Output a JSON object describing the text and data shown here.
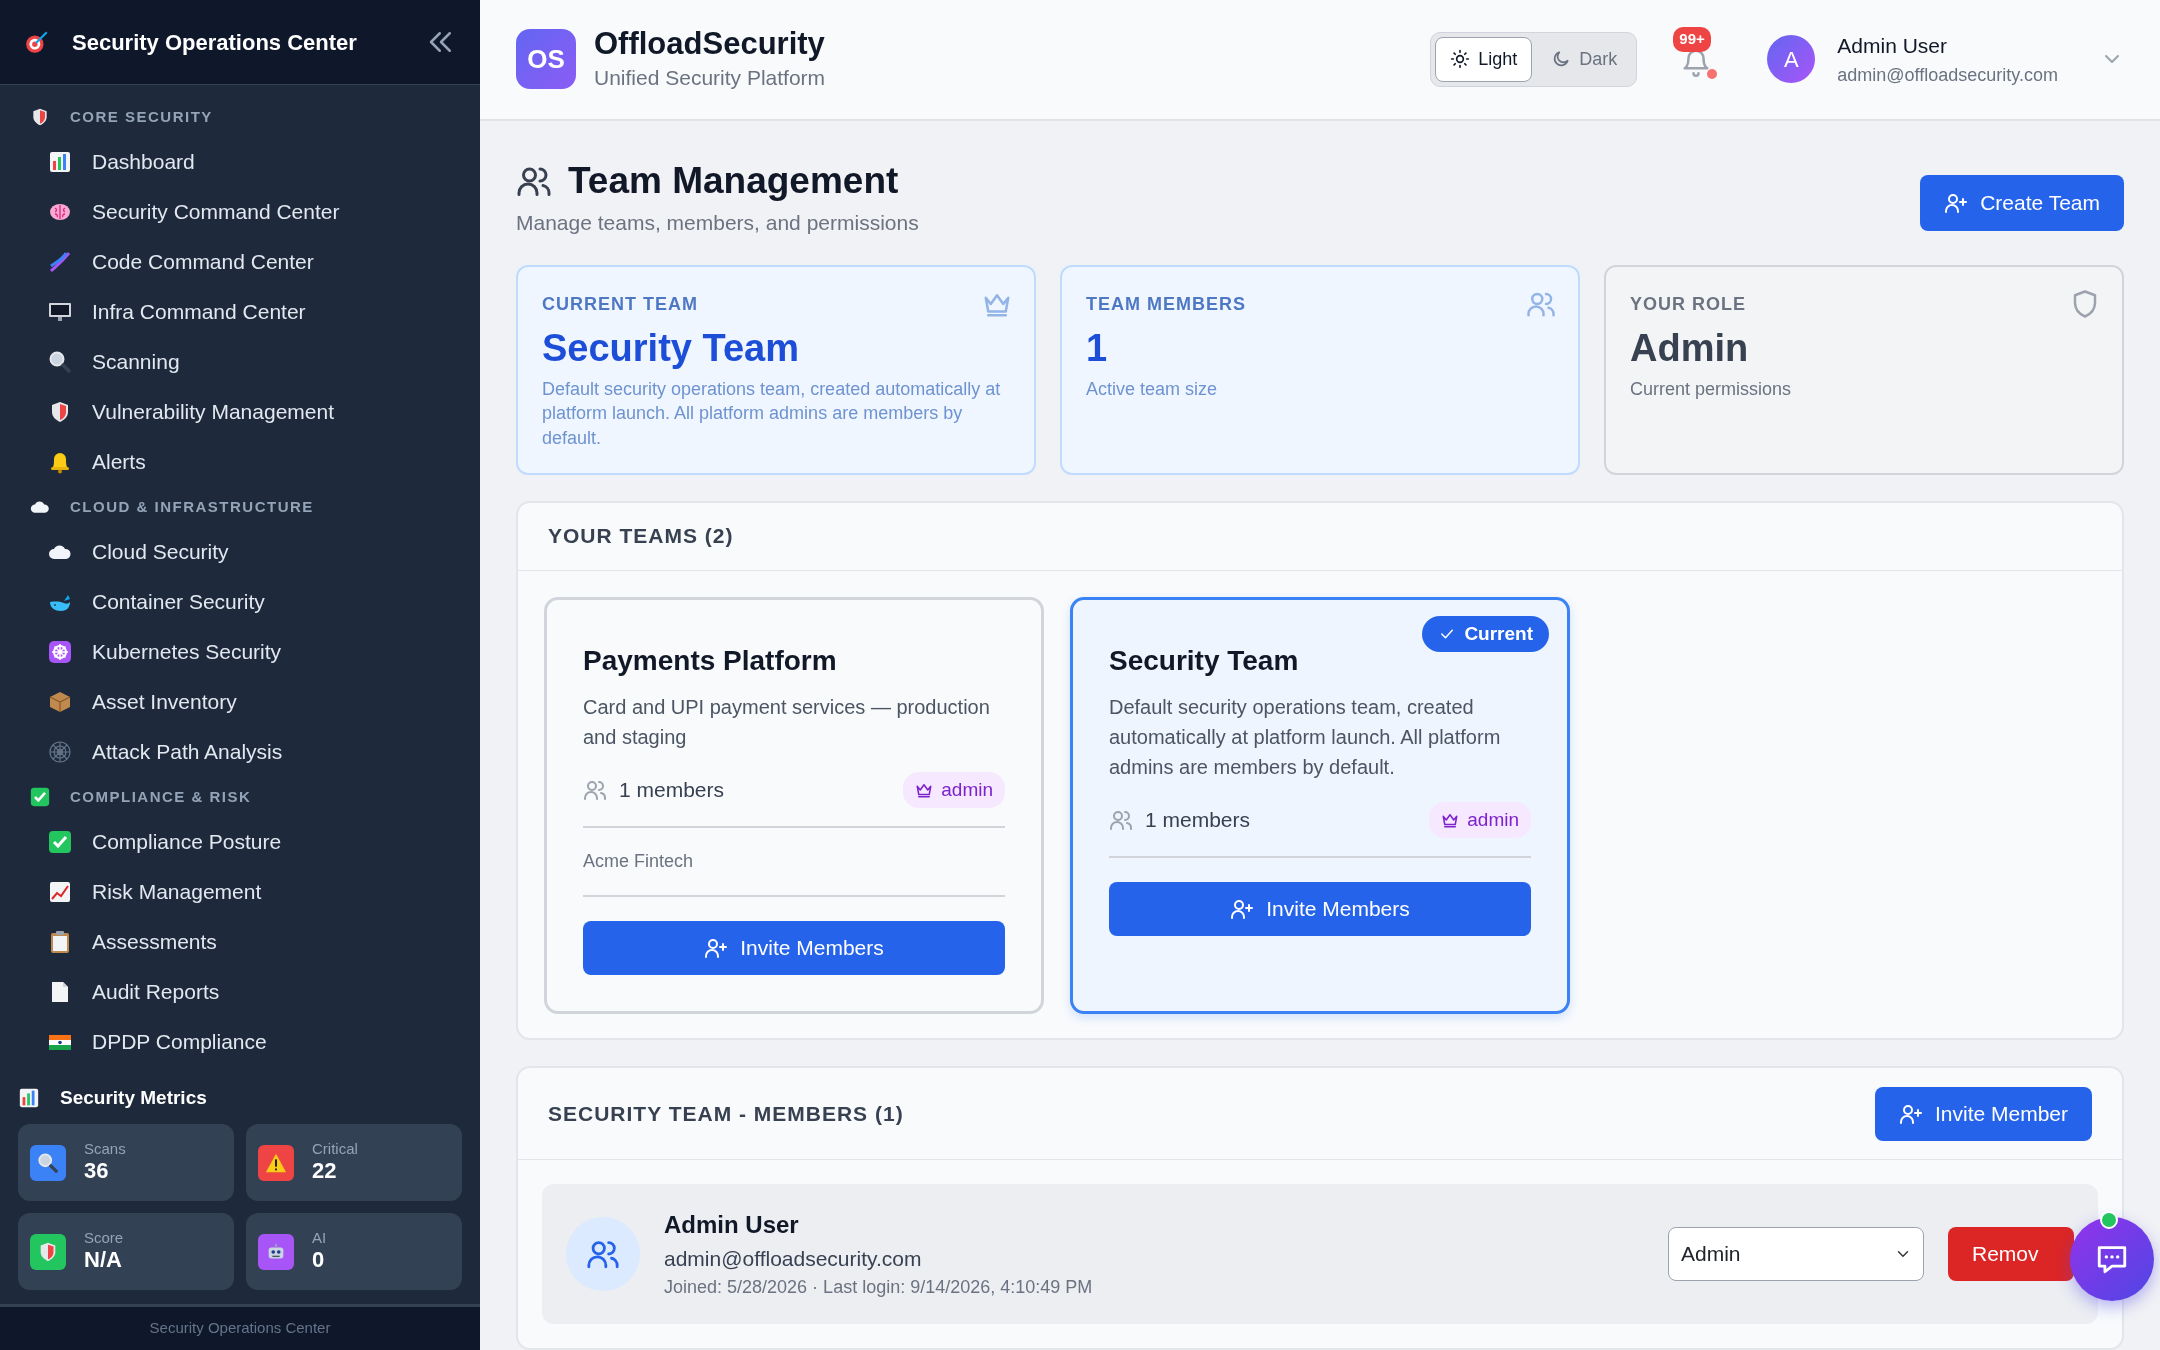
{
  "sidebar": {
    "title": "Security Operations Center",
    "sections": [
      {
        "label": "CORE SECURITY",
        "items": [
          {
            "label": "Dashboard"
          },
          {
            "label": "Security Command Center"
          },
          {
            "label": "Code Command Center"
          },
          {
            "label": "Infra Command Center"
          },
          {
            "label": "Scanning"
          },
          {
            "label": "Vulnerability Management"
          },
          {
            "label": "Alerts"
          }
        ]
      },
      {
        "label": "CLOUD & INFRASTRUCTURE",
        "items": [
          {
            "label": "Cloud Security"
          },
          {
            "label": "Container Security"
          },
          {
            "label": "Kubernetes Security"
          },
          {
            "label": "Asset Inventory"
          },
          {
            "label": "Attack Path Analysis"
          }
        ]
      },
      {
        "label": "COMPLIANCE & RISK",
        "items": [
          {
            "label": "Compliance Posture"
          },
          {
            "label": "Risk Management"
          },
          {
            "label": "Assessments"
          },
          {
            "label": "Audit Reports"
          },
          {
            "label": "DPDP Compliance"
          }
        ]
      }
    ],
    "metrics": {
      "title": "Security Metrics",
      "tiles": [
        {
          "label": "Scans",
          "value": "36",
          "color": "#3b82f6"
        },
        {
          "label": "Critical",
          "value": "22",
          "color": "#ef4444"
        },
        {
          "label": "Score",
          "value": "N/A",
          "color": "#22c55e"
        },
        {
          "label": "AI",
          "value": "0",
          "color": "#a855f7"
        }
      ]
    },
    "footer": "Security Operations Center"
  },
  "header": {
    "logo": "OS",
    "brand": "OffloadSecurity",
    "tagline": "Unified Security Platform",
    "theme_options": [
      {
        "label": "Light",
        "selected": true
      },
      {
        "label": "Dark",
        "selected": false
      }
    ],
    "notification_count": "99+",
    "user": {
      "initial": "A",
      "name": "Admin User",
      "email": "admin@offloadsecurity.com"
    }
  },
  "page": {
    "title": "Team Management",
    "subtitle": "Manage teams, members, and permissions",
    "create_button": "Create Team"
  },
  "stats": [
    {
      "kind": "team",
      "label": "CURRENT TEAM",
      "value": "Security Team",
      "note": "Default security operations team, created automatically at platform launch. All platform admins are members by default."
    },
    {
      "kind": "members",
      "label": "TEAM MEMBERS",
      "value": "1",
      "note": "Active team size"
    },
    {
      "kind": "role",
      "label": "YOUR ROLE",
      "value": "Admin",
      "note": "Current permissions"
    }
  ],
  "teams": {
    "title": "YOUR TEAMS (2)",
    "items": [
      {
        "name": "Payments Platform",
        "description": "Card and UPI payment services — production and staging",
        "members": "1 members",
        "role": "admin",
        "org": "Acme Fintech",
        "button": "Invite Members",
        "selected": false
      },
      {
        "name": "Security Team",
        "description": "Default security operations team, created automatically at platform launch. All platform admins are members by default.",
        "members": "1 members",
        "role": "admin",
        "badge": "Current",
        "button": "Invite Members",
        "selected": true
      }
    ]
  },
  "members": {
    "title": "SECURITY TEAM - MEMBERS (1)",
    "invite_button": "Invite Member",
    "rows": [
      {
        "name": "Admin User",
        "email": "admin@offloadsecurity.com",
        "meta": "Joined: 5/28/2026 · Last login: 9/14/2026, 4:10:49 PM",
        "role": "Admin",
        "remove_button": "Remov"
      }
    ]
  }
}
